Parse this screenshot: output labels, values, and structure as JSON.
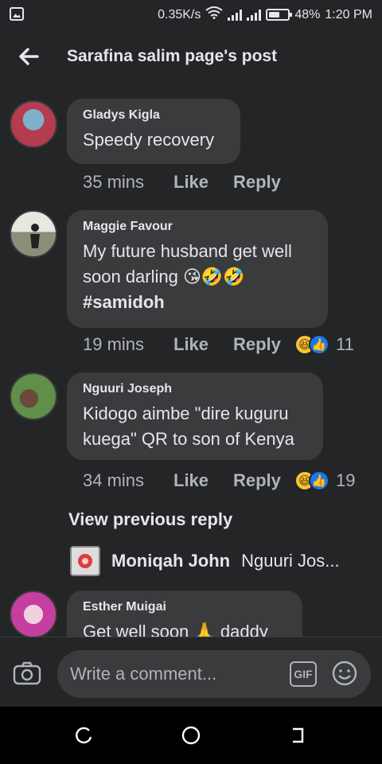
{
  "status_bar": {
    "speed": "0.35K/s",
    "battery": "48%",
    "time": "1:20 PM"
  },
  "header": {
    "title": "Sarafina salim page's post"
  },
  "comments": [
    {
      "name": "Gladys Kigla",
      "text": "Speedy recovery",
      "time": "35 mins",
      "like": "Like",
      "reply": "Reply"
    },
    {
      "name": "Maggie Favour",
      "text": "My future husband get well soon darling 😘🤣🤣",
      "hashtag": "#samidoh",
      "time": "19 mins",
      "like": "Like",
      "reply": "Reply",
      "reactions": "11"
    },
    {
      "name": "Nguuri Joseph",
      "text": "Kidogo aimbe \"dire kuguru kuega\" QR to son of Kenya",
      "time": "34 mins",
      "like": "Like",
      "reply": "Reply",
      "reactions": "19"
    },
    {
      "name": "Esther Muigai",
      "text": "Get well soon 🙏 daddy"
    }
  ],
  "view_previous": "View previous reply",
  "reply_preview": {
    "name": "Moniqah John",
    "text": "Nguuri Jos..."
  },
  "composer": {
    "placeholder": "Write a comment...",
    "gif": "GIF"
  },
  "colors": {
    "background": "#242527",
    "bubble": "#3a3b3c",
    "hashtag": "#4a9cf5",
    "like_react": "#1877f2"
  }
}
